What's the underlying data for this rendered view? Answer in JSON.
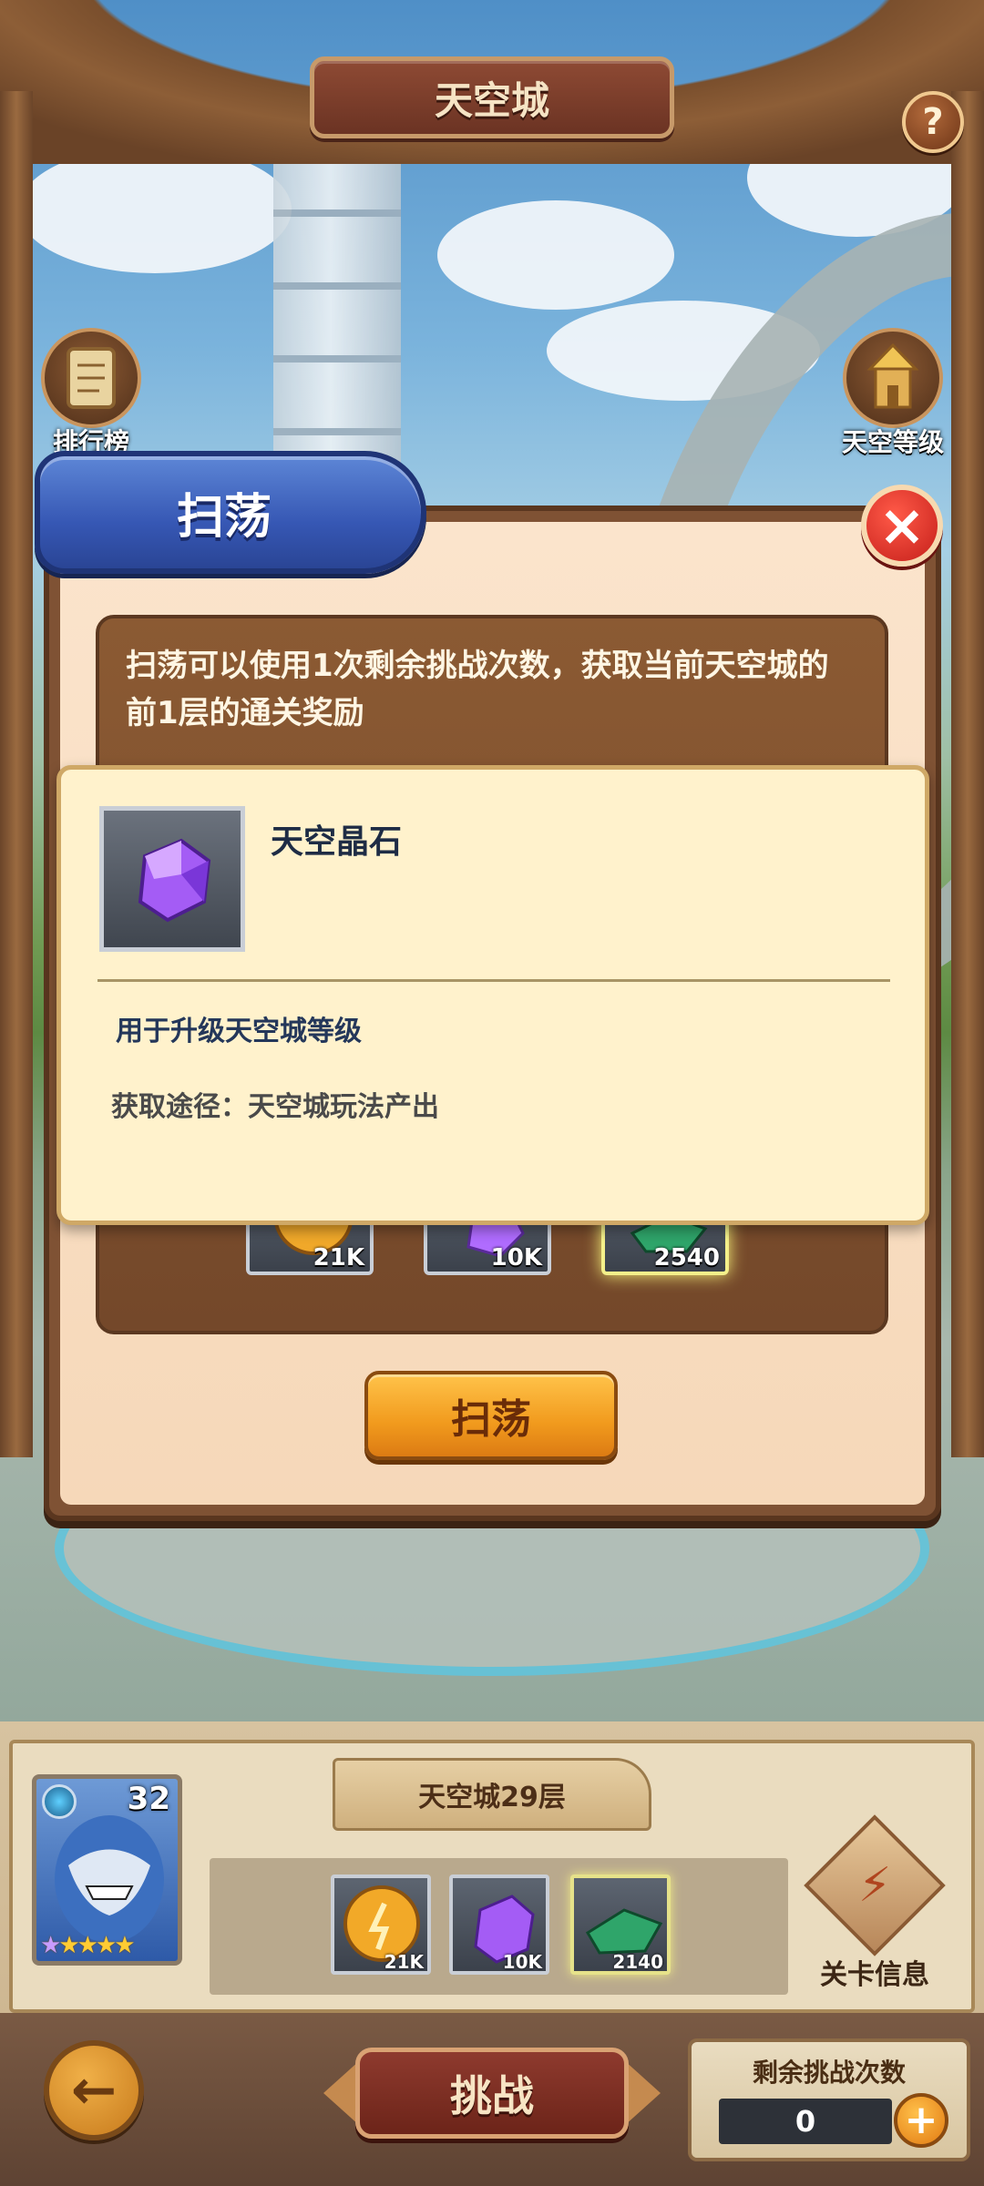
{
  "header": {
    "title": "天空城",
    "help_icon": "question-icon"
  },
  "side_buttons": {
    "left": {
      "label": "排行榜",
      "icon": "scroll-icon"
    },
    "right": {
      "label": "天空等级",
      "icon": "tower-icon"
    }
  },
  "sweep_dialog": {
    "title": "扫荡",
    "close_icon": "close-icon",
    "description": "扫荡可以使用1次剩余挑战次数，获取当前天空城的前1层的通关奖励",
    "rewards": [
      {
        "item": "coin",
        "amount": "21K"
      },
      {
        "item": "sky-crystal",
        "amount": "10K"
      },
      {
        "item": "green-material",
        "amount": "2540"
      }
    ],
    "button_label": "扫荡"
  },
  "item_tooltip": {
    "name": "天空晶石",
    "description": "用于升级天空城等级",
    "source": "获取途径：天空城玩法产出"
  },
  "stage": {
    "name": "天空城29层",
    "hero_level": "32",
    "hero_stars": 5,
    "drops": [
      {
        "item": "coin",
        "amount": "21K"
      },
      {
        "item": "sky-crystal",
        "amount": "10K"
      },
      {
        "item": "green-material",
        "amount": "2140"
      }
    ],
    "info_label": "关卡信息"
  },
  "actions": {
    "challenge_label": "挑战",
    "remaining_label": "剩余挑战次数",
    "remaining_count": "0"
  },
  "colors": {
    "dialog_title_blue": "#3657b4",
    "sweep_button_orange": "#f19a1d",
    "close_red": "#c51f1a",
    "crystal_purple": "#9b4dff"
  }
}
